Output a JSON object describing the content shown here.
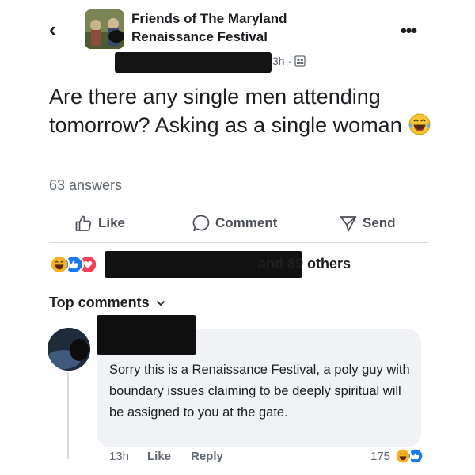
{
  "header": {
    "back_icon": "chevron-left-icon",
    "group_title": "Friends of The Maryland Renaissance Festival",
    "more_icon": "more-horizontal-icon",
    "post_time": "3h",
    "meta_separator": "·",
    "audience_icon": "group-audience-icon"
  },
  "post": {
    "text": "Are there any single men attending tomorrow? Asking as a single woman",
    "emoji": "laughing-tears-emoji",
    "answers": "63 answers"
  },
  "actions": {
    "like_label": "Like",
    "comment_label": "Comment",
    "send_label": "Send"
  },
  "reactions": {
    "others_text": "and 89 others",
    "icons": [
      "laugh-reaction-icon",
      "like-reaction-icon",
      "love-reaction-icon"
    ]
  },
  "comments": {
    "sort_label": "Top comments",
    "items": [
      {
        "text": "Sorry this is a Renaissance Festival, a poly guy with boundary issues claiming to be deeply spiritual will be assigned to you at the gate.",
        "time": "13h",
        "like_label": "Like",
        "reply_label": "Reply",
        "reaction_count": "175"
      }
    ]
  },
  "colors": {
    "like_blue": "#1877f2",
    "love_red": "#f33e58",
    "haha_yellow": "#f7b125",
    "muted_text": "#606770",
    "bubble_bg": "#f0f2f5"
  }
}
